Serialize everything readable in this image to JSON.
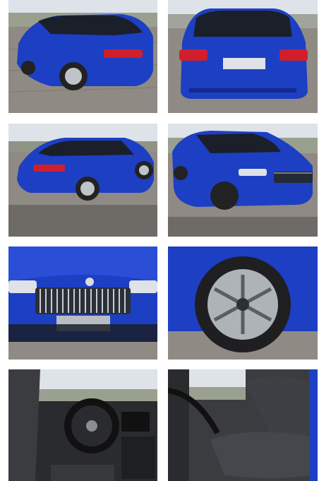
{
  "gallery": {
    "photos": [
      {
        "subject": "rear-three-quarter-left"
      },
      {
        "subject": "rear-view"
      },
      {
        "subject": "side-rear-left"
      },
      {
        "subject": "front-three-quarter-right"
      },
      {
        "subject": "front-grille-closeup"
      },
      {
        "subject": "alloy-wheel-closeup"
      },
      {
        "subject": "interior-dashboard"
      },
      {
        "subject": "interior-front-seat"
      }
    ]
  },
  "colors": {
    "body_blue": "#1d3fc4",
    "body_blue_dark": "#122a8c",
    "glass": "#1a1f2a",
    "taillight": "#d01f2a",
    "pavement": "#8f8a84",
    "sky": "#dde3e8",
    "interior_dark": "#2a2b2e"
  }
}
